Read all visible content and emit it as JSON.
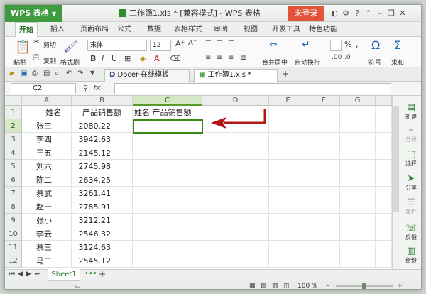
{
  "app": {
    "menu_button_label": "WPS 表格",
    "window_title": "工作簿1.xls * [兼容模式] - WPS 表格",
    "login_label": "未登录"
  },
  "menu": {
    "tabs": [
      "开始",
      "插入",
      "页面布局",
      "公式",
      "数据",
      "表格样式",
      "审阅",
      "视图",
      "开发工具",
      "特色功能"
    ]
  },
  "ribbon": {
    "paste_label": "粘贴",
    "cut_label": "剪切",
    "copy_label": "复制",
    "format_painter_label": "格式刷",
    "font_name": "宋体",
    "font_size": "12",
    "merge_label": "合并居中",
    "wrap_label": "自动换行",
    "symbol_label": "符号",
    "sum_label": "求和"
  },
  "tabs": {
    "docer_label": "Docer-在线模板",
    "workbook_label": "工作簿1.xls *"
  },
  "formula_bar": {
    "name_box": "C2",
    "fx_label": "fx"
  },
  "grid": {
    "columns": [
      "A",
      "B",
      "C",
      "D",
      "E",
      "F",
      "G"
    ],
    "rows": [
      {
        "n": "1",
        "a": "姓名",
        "b": "产品销售额"
      },
      {
        "n": "2",
        "a": "张三",
        "b": "2080.22"
      },
      {
        "n": "3",
        "a": "李四",
        "b": "3942.63"
      },
      {
        "n": "4",
        "a": "王五",
        "b": "2145.12"
      },
      {
        "n": "5",
        "a": "刘六",
        "b": "2745.98"
      },
      {
        "n": "6",
        "a": "陈二",
        "b": "2634.25"
      },
      {
        "n": "7",
        "a": "蔡武",
        "b": "3261.41"
      },
      {
        "n": "8",
        "a": "赵一",
        "b": "2785.91"
      },
      {
        "n": "9",
        "a": "张小",
        "b": "3212.21"
      },
      {
        "n": "10",
        "a": "李云",
        "b": "2546.32"
      },
      {
        "n": "11",
        "a": "蔡三",
        "b": "3124.63"
      },
      {
        "n": "12",
        "a": "马二",
        "b": "2545.12"
      }
    ],
    "c1_text": "姓名  产品销售额"
  },
  "right_panel": {
    "items": [
      "新建",
      "分析",
      "选择",
      "分享",
      "属性",
      "反馈",
      "备份"
    ]
  },
  "sheets": {
    "active_sheet": "Sheet1"
  },
  "status": {
    "zoom": "100 %"
  },
  "colors": {
    "accent_green": "#3f9b3f",
    "login_red": "#e2543a",
    "arrow_red": "#b01818"
  }
}
